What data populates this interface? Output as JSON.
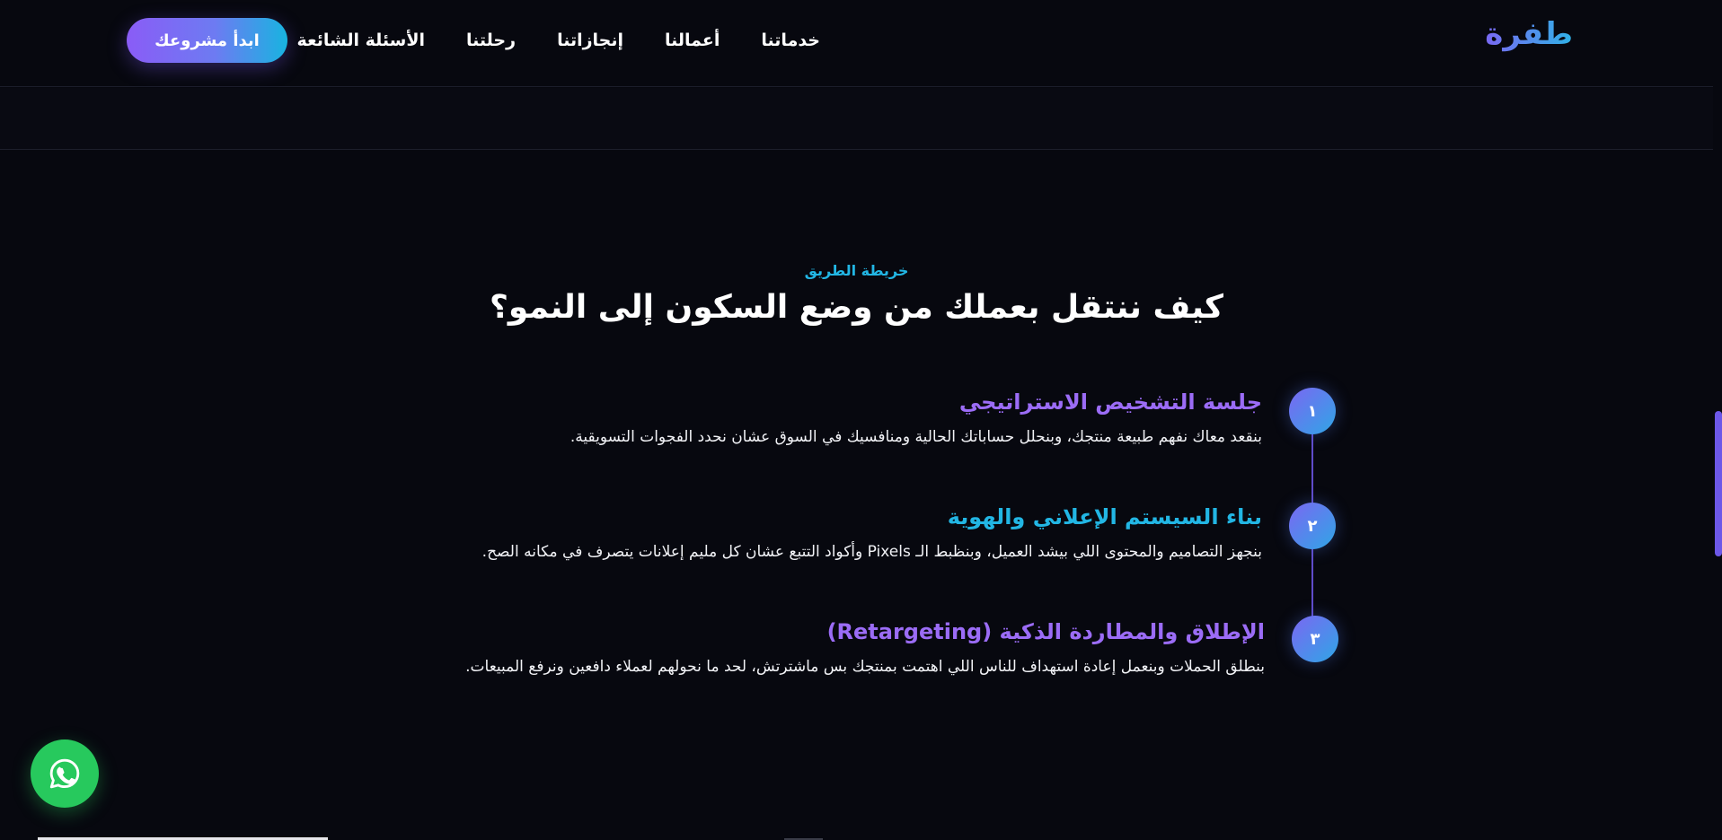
{
  "header": {
    "logo": "طفرة",
    "nav": [
      {
        "label": "خدماتنا"
      },
      {
        "label": "أعمالنا"
      },
      {
        "label": "إنجازاتنا"
      },
      {
        "label": "رحلتنا"
      },
      {
        "label": "الأسئلة الشائعة"
      }
    ],
    "cta_label": "ابدأ مشروعك"
  },
  "section": {
    "kicker": "خريطة الطريق",
    "title": "كيف ننتقل بعملك من وضع السكون إلى النمو؟",
    "steps": [
      {
        "number": "١",
        "title": "جلسة التشخيص الاستراتيجي",
        "title_color": "#9b6cf6",
        "description": "بنقعد معاك نفهم طبيعة منتجك، وبنحلل حساباتك الحالية ومنافسيك في السوق عشان نحدد الفجوات التسويقية."
      },
      {
        "number": "٢",
        "title": "بناء السيستم الإعلاني والهوية",
        "title_color": "#22b6e4",
        "description": "بنجهز التصاميم والمحتوى اللي بيشد العميل، وبنظبط الـ Pixels وأكواد التتبع عشان كل مليم إعلانات يتصرف في مكانه الصح."
      },
      {
        "number": "٣",
        "title": "الإطلاق والمطاردة الذكية (Retargeting)",
        "title_color": "#9b6cf6",
        "description": "بنطلق الحملات وبنعمل إعادة استهداف للناس اللي اهتمت بمنتجك بس ماشترتش، لحد ما نحولهم لعملاء دافعين ونرفع المبيعات."
      }
    ]
  },
  "colors": {
    "background": "#07080f",
    "accent_blue": "#22b6e4",
    "accent_purple": "#9b6cf6",
    "whatsapp_green": "#27c95d"
  },
  "icons": {
    "whatsapp": "whatsapp-icon"
  }
}
